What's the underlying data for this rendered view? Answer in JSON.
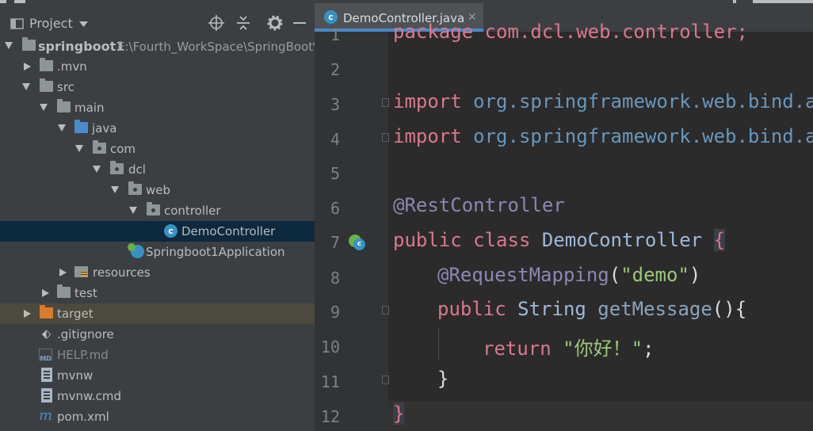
{
  "project_panel": {
    "title": "Project",
    "header_icons": [
      "dropdown-arrow-icon",
      "locate-icon",
      "collapse-all-icon",
      "gear-icon",
      "minimize-icon"
    ],
    "tree": [
      {
        "label": "springboot1",
        "path": "E:\\Fourth_WorkSpace\\SpringBoot\\",
        "icon": "module-folder-icon",
        "expanded": true
      },
      {
        "label": ".mvn",
        "icon": "folder-icon",
        "expanded": false
      },
      {
        "label": "src",
        "icon": "folder-icon",
        "expanded": true
      },
      {
        "label": "main",
        "icon": "folder-icon",
        "expanded": true
      },
      {
        "label": "java",
        "icon": "source-folder-icon",
        "expanded": true
      },
      {
        "label": "com",
        "icon": "package-icon",
        "expanded": true
      },
      {
        "label": "dcl",
        "icon": "package-icon",
        "expanded": true
      },
      {
        "label": "web",
        "icon": "package-icon",
        "expanded": true
      },
      {
        "label": "controller",
        "icon": "package-icon",
        "expanded": true
      },
      {
        "label": "DemoController",
        "icon": "class-icon",
        "selected": true
      },
      {
        "label": "Springboot1Application",
        "icon": "spring-boot-class-icon"
      },
      {
        "label": "resources",
        "icon": "resources-folder-icon",
        "expanded": false
      },
      {
        "label": "test",
        "icon": "folder-icon",
        "expanded": false
      },
      {
        "label": "target",
        "icon": "excluded-folder-icon",
        "expanded": false
      },
      {
        "label": ".gitignore",
        "icon": "git-icon"
      },
      {
        "label": "HELP.md",
        "icon": "markdown-icon"
      },
      {
        "label": "mvnw",
        "icon": "file-icon"
      },
      {
        "label": "mvnw.cmd",
        "icon": "file-icon"
      },
      {
        "label": "pom.xml",
        "icon": "maven-icon"
      }
    ]
  },
  "editor": {
    "active_tab": "DemoController.java",
    "line_numbers": [
      "1",
      "2",
      "3",
      "4",
      "5",
      "6",
      "7",
      "8",
      "9",
      "10",
      "11",
      "12"
    ],
    "code": {
      "l1": "package com.dcl.web.controller;",
      "l3_kw": "import",
      "l3_rest": " org.springframework.web.bind.an",
      "l4_kw": "import",
      "l4_rest": " org.springframework.web.bind.an",
      "l6": "@RestController",
      "l7_kw": "public class",
      "l7_name": " DemoController ",
      "l7_brace": "{",
      "l8_ann": "@RequestMapping",
      "l8_open": "(",
      "l8_str": "\"demo\"",
      "l8_close": ")",
      "l9_kw": "public",
      "l9_type": " String ",
      "l9_method": "getMessage",
      "l9_rest": "(){",
      "l10_kw": "return",
      "l10_str": " \"你好！\"",
      "l10_semi": ";",
      "l11": "}",
      "l12": "}"
    }
  },
  "colors": {
    "background": "#2b2b2b",
    "panel": "#3c3f41",
    "selection": "#0d293e",
    "keyword": "#d9788e",
    "string": "#6a8759",
    "accent": "#4a88c7"
  }
}
